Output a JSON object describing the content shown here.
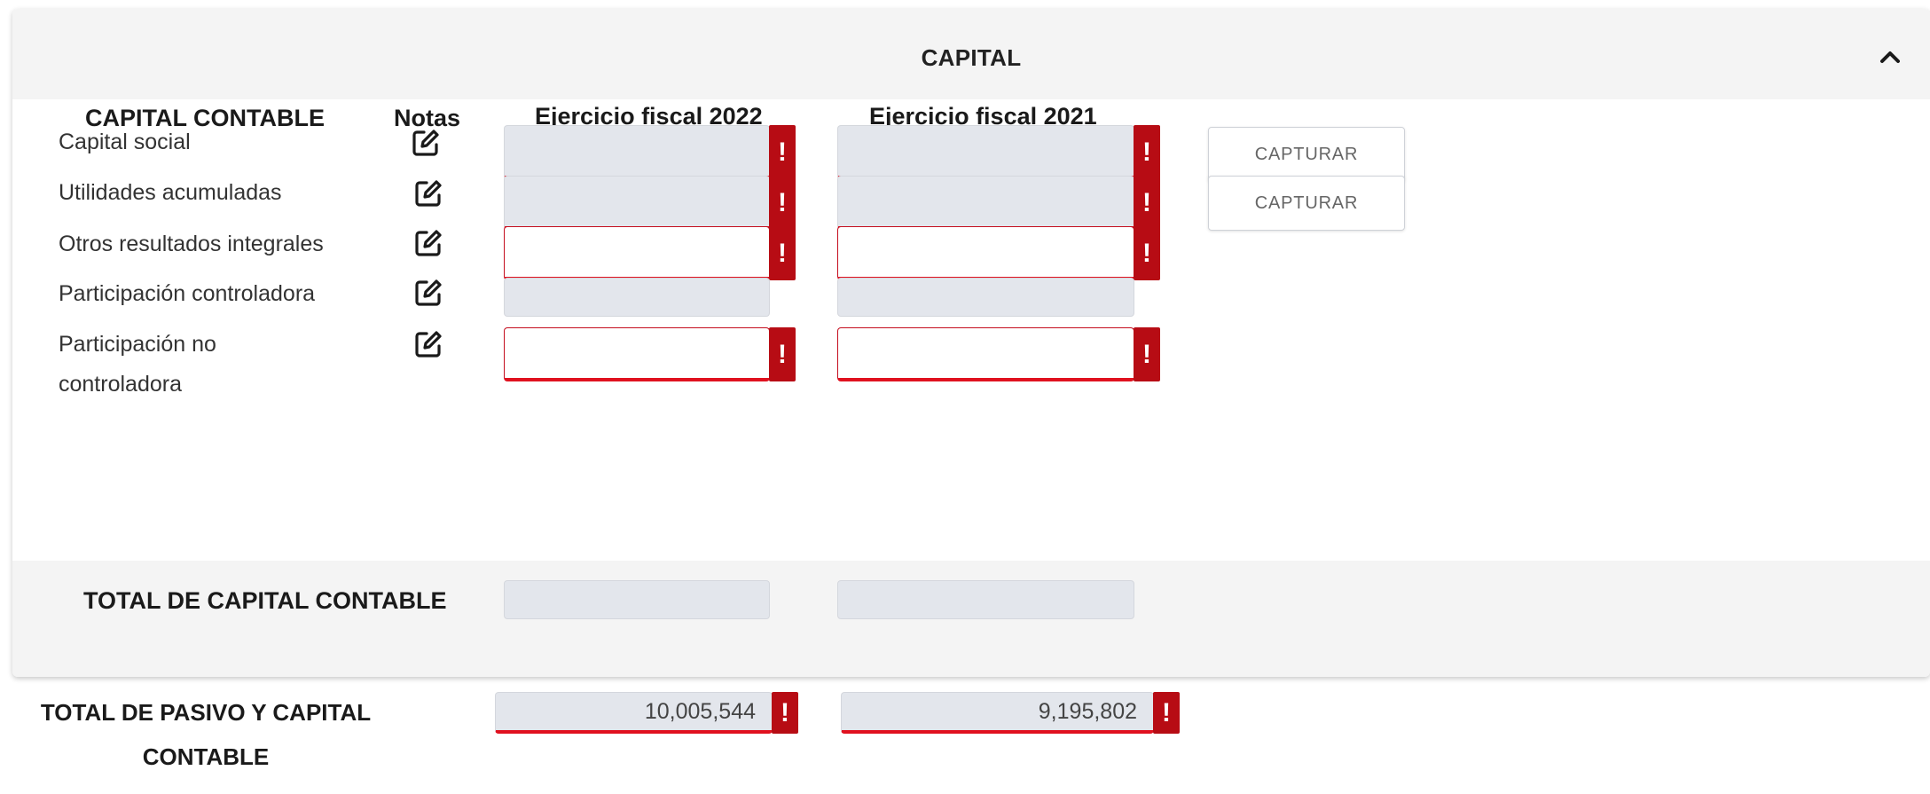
{
  "section": {
    "title": "CAPITAL",
    "collapse_icon": "chevron-up-icon"
  },
  "columns": {
    "concept": "CAPITAL CONTABLE",
    "notes": "Notas",
    "year_2022": "Ejercicio fiscal 2022",
    "year_2021": "Ejercicio fiscal 2021"
  },
  "rows": [
    {
      "label": "Capital social",
      "value_2022": "",
      "value_2021": "",
      "capture_label": "CAPTURAR"
    },
    {
      "label": "Utilidades acumuladas",
      "value_2022": "",
      "value_2021": "",
      "capture_label": "CAPTURAR"
    },
    {
      "label": "Otros resultados integrales",
      "value_2022": "",
      "value_2021": ""
    },
    {
      "label": "Participación controladora",
      "value_2022": "",
      "value_2021": ""
    },
    {
      "label": "Participación no controladora",
      "label_line1": "Participación no",
      "label_line2": "controladora",
      "value_2022": "",
      "value_2021": ""
    }
  ],
  "error_marker": "!",
  "note_icon": "edit-note-icon",
  "total_capital": {
    "label": "TOTAL DE CAPITAL CONTABLE",
    "value_2022": "",
    "value_2021": ""
  },
  "total_liabilities_capital": {
    "label_line1": "TOTAL DE PASIVO Y CAPITAL",
    "label_line2": "CONTABLE",
    "value_2022": "10,005,544",
    "value_2021": "9,195,802"
  },
  "colors": {
    "error_red": "#b70c14",
    "error_underline": "#e0111f",
    "readonly_field": "#e3e6ec",
    "header_bg": "#f4f4f4"
  }
}
